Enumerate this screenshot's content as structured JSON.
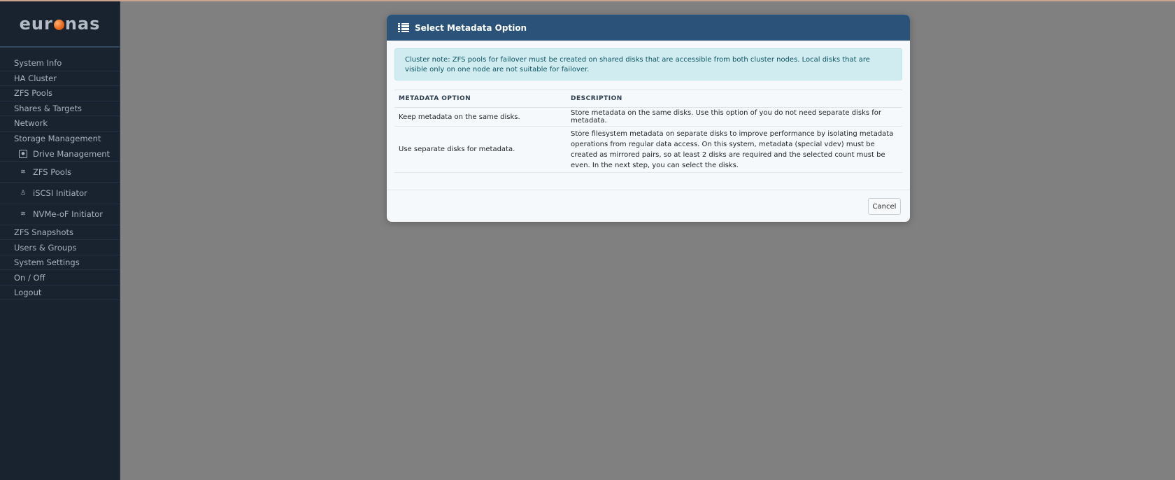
{
  "brand": {
    "logo_left": "eur",
    "logo_right": "nas"
  },
  "sidebar": {
    "items_top": [
      {
        "label": "System Info"
      },
      {
        "label": "HA Cluster"
      },
      {
        "label": "ZFS Pools"
      },
      {
        "label": "Shares & Targets"
      },
      {
        "label": "Network"
      },
      {
        "label": "Storage Management"
      }
    ],
    "subitems": [
      {
        "label": "Drive Management",
        "icon": "drive-icon"
      },
      {
        "label": "ZFS Pools",
        "icon": "layers-icon"
      },
      {
        "label": "iSCSI Initiator",
        "icon": "person-icon"
      },
      {
        "label": "NVMe-oF Initiator",
        "icon": "layers-icon"
      }
    ],
    "items_bottom": [
      {
        "label": "ZFS Snapshots"
      },
      {
        "label": "Users & Groups"
      },
      {
        "label": "System Settings"
      },
      {
        "label": "On / Off"
      },
      {
        "label": "Logout"
      }
    ]
  },
  "modal": {
    "title": "Select Metadata Option",
    "alert": "Cluster note: ZFS pools for failover must be created on shared disks that are accessible from both cluster nodes. Local disks that are visible only on one node are not suitable for failover.",
    "columns": [
      "METADATA OPTION",
      "DESCRIPTION"
    ],
    "rows": [
      {
        "option": "Keep metadata on the same disks.",
        "description": "Store metadata on the same disks. Use this option of you do not need separate disks for metadata."
      },
      {
        "option": "Use separate disks for metadata.",
        "description": "Store filesystem metadata on separate disks to improve performance by isolating metadata operations from regular data access. On this system, metadata (special vdev) must be created as mirrored pairs, so at least 2 disks are required and the selected count must be even. In the next step, you can select the disks."
      }
    ],
    "cancel_label": "Cancel"
  },
  "colors": {
    "header": "#2b5279",
    "sidebar": "#19232f",
    "overlay": "#808080",
    "alert_bg": "#d1ecf1",
    "logo_accent": "#e8641a"
  }
}
